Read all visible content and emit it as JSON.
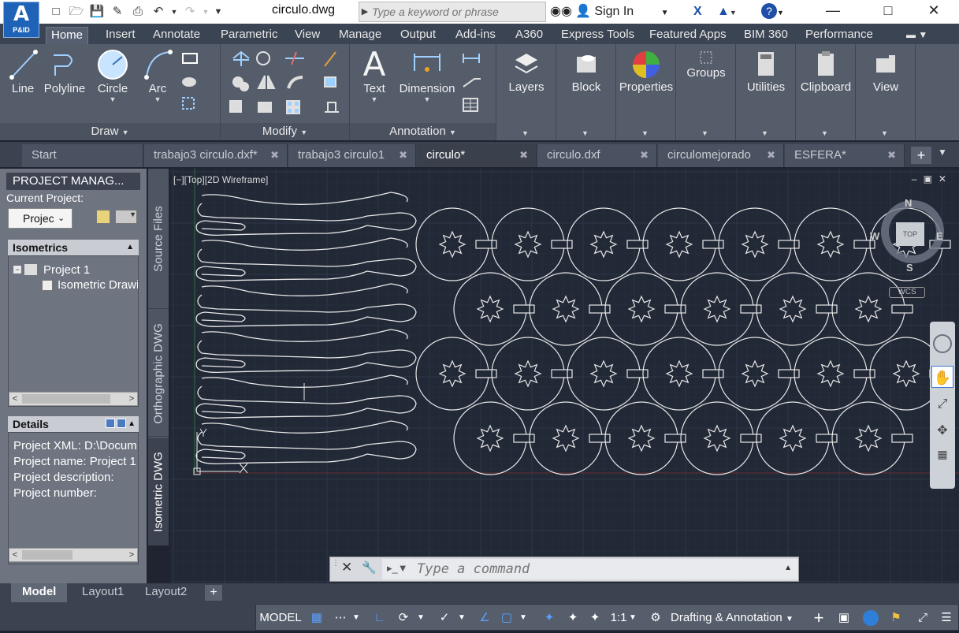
{
  "app": {
    "badge": "P&ID",
    "doc_title": "circulo.dwg",
    "search_placeholder": "Type a keyword or phrase",
    "sign_in": "Sign In"
  },
  "ribbon_tabs": [
    "Home",
    "Insert",
    "Annotate",
    "Parametric",
    "View",
    "Manage",
    "Output",
    "Add-ins",
    "A360",
    "Express Tools",
    "Featured Apps",
    "BIM 360",
    "Performance"
  ],
  "ribbon": {
    "draw": {
      "title": "Draw",
      "line": "Line",
      "polyline": "Polyline",
      "circle": "Circle",
      "arc": "Arc"
    },
    "modify": {
      "title": "Modify"
    },
    "annotation": {
      "title": "Annotation",
      "text": "Text",
      "dimension": "Dimension"
    },
    "layers": "Layers",
    "block": "Block",
    "properties": "Properties",
    "groups": "Groups",
    "utilities": "Utilities",
    "clipboard": "Clipboard",
    "view": "View"
  },
  "doc_tabs": [
    {
      "label": "Start",
      "closable": false,
      "active": false
    },
    {
      "label": "trabajo3 circulo.dxf*",
      "closable": true,
      "active": false
    },
    {
      "label": "trabajo3 circulo1",
      "closable": true,
      "active": false
    },
    {
      "label": "circulo*",
      "closable": true,
      "active": true
    },
    {
      "label": "circulo.dxf",
      "closable": true,
      "active": false
    },
    {
      "label": "circulomejorado",
      "closable": true,
      "active": false
    },
    {
      "label": "ESFERA*",
      "closable": true,
      "active": false
    }
  ],
  "project_manager": {
    "title": "PROJECT MANAG...",
    "current_project_label": "Current Project:",
    "project_combo": "Projec",
    "isometrics_header": "Isometrics",
    "tree_root": "Project 1",
    "tree_child": "Isometric Drawi",
    "details_header": "Details",
    "details": {
      "xml": "Project XML: D:\\Docum",
      "name": "Project name: Project 1",
      "description": "Project description:",
      "number": "Project number:"
    },
    "side_tabs": [
      "Source Files",
      "Orthographic DWG",
      "Isometric DWG"
    ]
  },
  "viewport": {
    "label": "[−][Top][2D Wireframe]",
    "viewcube": {
      "top": "TOP",
      "n": "N",
      "s": "S",
      "e": "E",
      "w": "W",
      "wcs": "WCS"
    }
  },
  "command_line": {
    "placeholder": "Type a command"
  },
  "layout_tabs": [
    "Model",
    "Layout1",
    "Layout2"
  ],
  "status_bar": {
    "model": "MODEL",
    "scale": "1:1",
    "workspace": "Drafting & Annotation"
  },
  "colors": {
    "accent": "#1e63b8",
    "canvas": "#212836",
    "ribbon": "#555d6b"
  }
}
